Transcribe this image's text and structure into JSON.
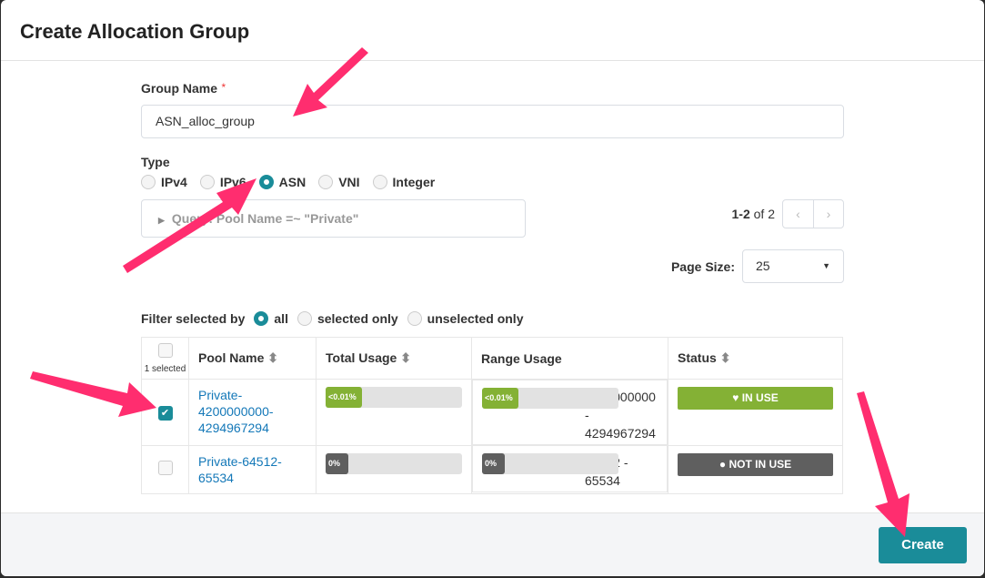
{
  "title": "Create Allocation Group",
  "group_name": {
    "label": "Group Name",
    "required": "*",
    "value": "ASN_alloc_group"
  },
  "type": {
    "label": "Type",
    "options": [
      "IPv4",
      "IPv6",
      "ASN",
      "VNI",
      "Integer"
    ],
    "selected": "ASN"
  },
  "query": "Query: Pool Name =~ \"Private\"",
  "pager": {
    "range": "1-2",
    "of": "of 2",
    "prev": "‹",
    "next": "›"
  },
  "page_size": {
    "label": "Page Size:",
    "value": "25"
  },
  "filter": {
    "label": "Filter selected by",
    "options": [
      "all",
      "selected only",
      "unselected only"
    ],
    "selected": "all"
  },
  "table": {
    "selected_count": "1 selected",
    "headers": [
      "Pool Name",
      "Total Usage",
      "Range Usage",
      "Status"
    ],
    "rows": [
      {
        "checked": true,
        "pool": "Private-4200000000-4294967294",
        "total_usage": "<0.01%",
        "range_usage": "<0.01%",
        "range": "4200000000 - 4294967294",
        "status": "IN USE"
      },
      {
        "checked": false,
        "pool": "Private-64512-65534",
        "total_usage": "0%",
        "range_usage": "0%",
        "range": "64512 - 65534",
        "status": "NOT IN USE"
      }
    ]
  },
  "create_label": "Create",
  "colors": {
    "accent": "#1a8c99",
    "in_use": "#84b135",
    "not_in_use": "#5f5f5f",
    "arrow": "#ff2d6f"
  }
}
